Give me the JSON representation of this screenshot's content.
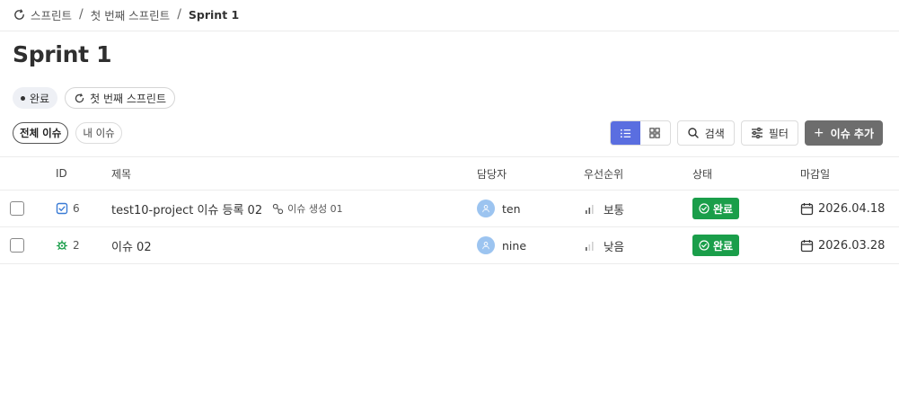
{
  "breadcrumb": {
    "items": [
      "스프린트",
      "첫 번째 스프린트"
    ],
    "current": "Sprint 1"
  },
  "page": {
    "title": "Sprint 1"
  },
  "tags": {
    "status": "완료",
    "sprint": "첫 번째 스프린트"
  },
  "filters": {
    "all": "전체 이슈",
    "mine": "내 이슈"
  },
  "toolbar": {
    "search": "검색",
    "filter": "필터",
    "add": "이슈 추가"
  },
  "table": {
    "headers": {
      "id": "ID",
      "title": "제목",
      "assignee": "담당자",
      "priority": "우선순위",
      "status": "상태",
      "due": "마감일"
    },
    "rows": [
      {
        "id": "6",
        "type_icon": "task-check-icon",
        "title": "test10-project 이슈 등록 02",
        "link": "이슈 생성 01",
        "assignee": "ten",
        "priority": "보통",
        "status": "완료",
        "due": "2026.04.18"
      },
      {
        "id": "2",
        "type_icon": "bug-icon",
        "title": "이슈 02",
        "link": "",
        "assignee": "nine",
        "priority": "낮음",
        "status": "완료",
        "due": "2026.03.28"
      }
    ]
  },
  "colors": {
    "accent": "#5a6ee0",
    "status_done": "#1a9e4a",
    "add_button": "#6d6d6d",
    "avatar": "#9cc4f0"
  }
}
